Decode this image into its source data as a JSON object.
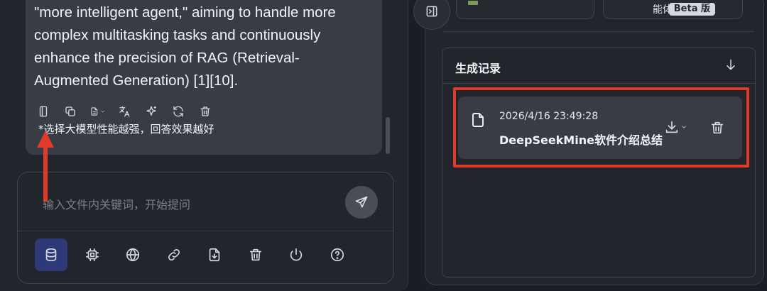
{
  "chat": {
    "message_lines": [
      "\"more intelligent agent,\" aiming to handle more",
      "complex multitasking tasks and continuously",
      "enhance the precision of RAG (Retrieval-",
      "Augmented Generation) [1][10]."
    ],
    "note": "*选择大模型性能越强，回答效果越好",
    "message_tools": [
      "copy-doc-icon",
      "copy-icon",
      "document-icon",
      "translate-icon",
      "sparkle-icon",
      "regenerate-icon",
      "trash-icon"
    ]
  },
  "input": {
    "placeholder": "输入文件内关键词，开始提问",
    "tools": [
      "database-icon",
      "chip-icon",
      "globe-icon",
      "link-icon",
      "file-download-icon",
      "trash-icon",
      "power-icon",
      "help-icon"
    ],
    "active_tool": "database-icon"
  },
  "top_cards": {
    "card2_label": "能体",
    "card2_badge": "Beta 版"
  },
  "records": {
    "title": "生成记录",
    "items": [
      {
        "time": "2026/4/16 23:49:28",
        "name": "DeepSeekMine软件介绍总结"
      }
    ]
  },
  "colors": {
    "background": "#1a1d23",
    "panel": "#22252c",
    "card": "#383c45",
    "highlight": "#e03a2a",
    "active_tool": "#2e3a78"
  }
}
